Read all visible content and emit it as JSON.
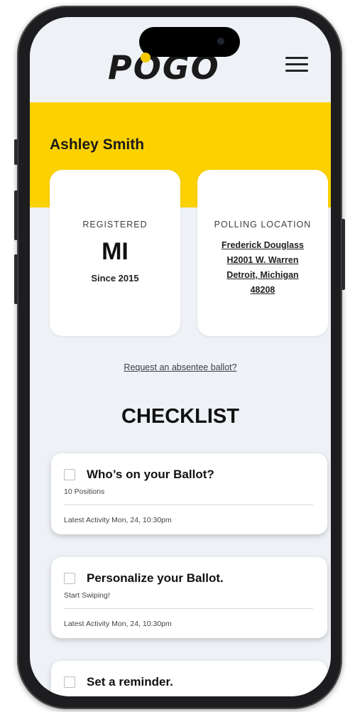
{
  "app": {
    "logo_text": "POGO"
  },
  "profile": {
    "name": "Ashley Smith"
  },
  "registered_card": {
    "label": "REGISTERED",
    "state": "MI",
    "since": "Since 2015"
  },
  "polling_card": {
    "label": "POLLING LOCATION",
    "address_lines": [
      "Frederick Douglass",
      "H2001 W. Warren",
      "Detroit, Michigan",
      "48208"
    ]
  },
  "absentee_link": "Request an absentee ballot?",
  "checklist": {
    "title": "CHECKLIST",
    "items": [
      {
        "title": "Who’s on your Ballot?",
        "subtitle": "10 Positions",
        "activity": "Latest Activity Mon, 24, 10:30pm",
        "checked": false
      },
      {
        "title": "Personalize your Ballot.",
        "subtitle": "Start Swiping!",
        "activity": "Latest Activity Mon, 24, 10:30pm",
        "checked": false
      },
      {
        "title": "Set a reminder.",
        "checked": false
      }
    ]
  },
  "colors": {
    "accent_yellow": "#fbd102",
    "background": "#eef1f5",
    "card": "#ffffff",
    "text": "#111111"
  },
  "icons": [
    "menu-icon",
    "checkbox-icon"
  ]
}
